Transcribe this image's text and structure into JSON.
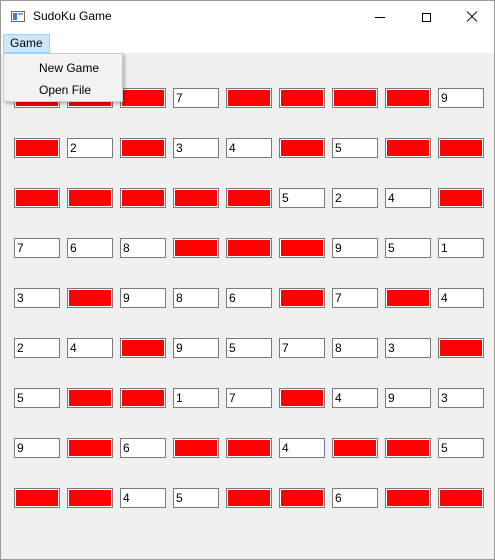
{
  "window": {
    "title": "SudoKu Game",
    "icon": "app-icon",
    "controls": [
      "minimize-icon",
      "maximize-icon",
      "close-icon"
    ]
  },
  "menubar": {
    "items": [
      {
        "label": "Game"
      }
    ]
  },
  "dropdown": {
    "items": [
      {
        "label": "New Game"
      },
      {
        "label": "Open File"
      }
    ]
  },
  "colors": {
    "filled_cell": "#ff0000",
    "empty_cell": "#ffffff",
    "background": "#f0f0f0",
    "menu_highlight": "#cce8ff"
  },
  "grid": [
    [
      "",
      "",
      "",
      "7",
      "",
      "",
      "",
      "",
      "9"
    ],
    [
      "",
      "2",
      "",
      "3",
      "4",
      "",
      "5",
      "",
      ""
    ],
    [
      "",
      "",
      "",
      "",
      "",
      "5",
      "2",
      "4",
      ""
    ],
    [
      "7",
      "6",
      "8",
      "",
      "",
      "",
      "9",
      "5",
      "1"
    ],
    [
      "3",
      "",
      "9",
      "8",
      "6",
      "",
      "7",
      "",
      "4"
    ],
    [
      "2",
      "4",
      "",
      "9",
      "5",
      "7",
      "8",
      "3",
      ""
    ],
    [
      "5",
      "",
      "",
      "1",
      "7",
      "",
      "4",
      "9",
      "3"
    ],
    [
      "9",
      "",
      "6",
      "",
      "",
      "4",
      "",
      "",
      "5"
    ],
    [
      "",
      "",
      "4",
      "5",
      "",
      "",
      "6",
      "",
      ""
    ]
  ]
}
